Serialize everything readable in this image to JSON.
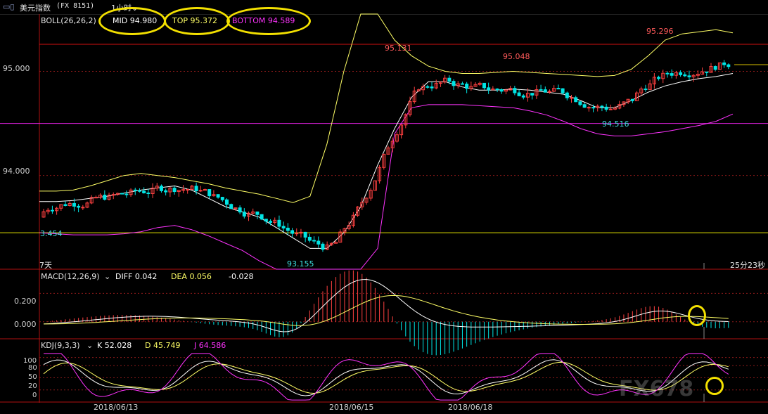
{
  "window": {
    "title": "美元指数",
    "code": "(FX 8151)",
    "period": "1小时",
    "back_icon": "restore-icon"
  },
  "boll": {
    "label": "BOLL(26,26,2)",
    "mid": "MID 94.980",
    "top": "TOP 95.372",
    "bottom": "BOTTOM 94.589"
  },
  "macd": {
    "label": "MACD(12,26,9)",
    "diff": "DIFF 0.042",
    "dea": "DEA 0.056",
    "macd": "-0.028"
  },
  "kdj": {
    "label": "KDJ(9,3,3)",
    "k": "K 52.028",
    "d": "D 45.749",
    "j": "J 64.586"
  },
  "price_axis": [
    "95.000",
    "94.000"
  ],
  "macd_axis": [
    "0.200",
    "0.000"
  ],
  "kdj_axis": [
    "100",
    "80",
    "50",
    "20",
    "0"
  ],
  "dates": [
    "2018/06/13",
    "2018/06/15",
    "2018/06/18"
  ],
  "countdown": "25分23秒",
  "period_left": "7天",
  "annotations": {
    "p95131": "95.131",
    "p95048": "95.048",
    "p95296": "95.296",
    "p94516": "94.516",
    "p93155": "93.155",
    "p93454": "3.454"
  },
  "watermark": "FX678",
  "colors": {
    "up": "#ff4040",
    "down": "#00e5e5",
    "mid": "#ffffff",
    "top": "#ffff66",
    "bottom": "#ff33ff",
    "guide_red": "#d01010",
    "guide_mag": "#e020e0",
    "guide_yel": "#e0e000"
  },
  "chart_data": {
    "type": "candlestick",
    "price_range": [
      93.1,
      95.55
    ],
    "guide_levels": {
      "red": 95.26,
      "magenta": 94.5,
      "yellow": 93.45
    },
    "boll_mid": [
      93.75,
      93.75,
      93.76,
      93.78,
      93.8,
      93.83,
      93.86,
      93.88,
      93.9,
      93.86,
      93.78,
      93.7,
      93.65,
      93.6,
      93.5,
      93.4,
      93.3,
      93.3,
      93.45,
      93.7,
      94.1,
      94.45,
      94.75,
      94.9,
      94.9,
      94.85,
      94.82,
      94.82,
      94.83,
      94.82,
      94.8,
      94.78,
      94.72,
      94.65,
      94.65,
      94.72,
      94.8,
      94.86,
      94.9,
      94.93,
      94.95,
      94.98
    ],
    "boll_top": [
      93.85,
      93.85,
      93.86,
      93.9,
      93.95,
      94.0,
      94.02,
      94.0,
      93.98,
      93.95,
      93.92,
      93.88,
      93.85,
      93.82,
      93.78,
      93.74,
      93.8,
      94.3,
      95.0,
      95.55,
      95.55,
      95.3,
      95.15,
      95.05,
      95.0,
      94.98,
      94.98,
      94.99,
      95.0,
      94.99,
      94.98,
      94.97,
      94.96,
      94.95,
      94.96,
      95.02,
      95.15,
      95.3,
      95.36,
      95.38,
      95.4,
      95.37
    ],
    "boll_bottom": [
      93.45,
      93.44,
      93.43,
      93.43,
      93.43,
      93.44,
      93.46,
      93.5,
      93.52,
      93.48,
      93.42,
      93.35,
      93.28,
      93.18,
      93.08,
      93.0,
      92.9,
      92.4,
      91.9,
      92.0,
      93.3,
      94.4,
      94.65,
      94.68,
      94.68,
      94.68,
      94.67,
      94.66,
      94.65,
      94.62,
      94.58,
      94.52,
      94.45,
      94.4,
      94.38,
      94.38,
      94.4,
      94.42,
      94.45,
      94.48,
      94.52,
      94.59
    ],
    "macd_range": [
      -0.12,
      0.37
    ],
    "kdj_range": [
      -10,
      115
    ]
  }
}
